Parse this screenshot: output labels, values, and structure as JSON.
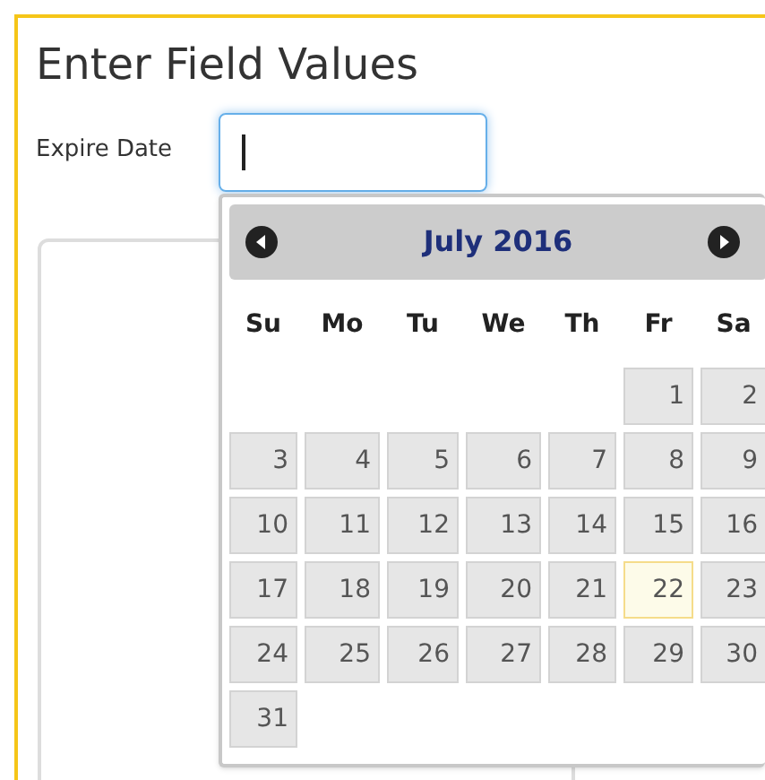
{
  "title": "Enter Field Values",
  "field": {
    "label": "Expire Date",
    "focused": true
  },
  "datepicker": {
    "month_title": "July 2016",
    "weekdays": [
      "Su",
      "Mo",
      "Tu",
      "We",
      "Th",
      "Fr",
      "Sa"
    ],
    "weeks": [
      [
        {
          "label": "1",
          "today": false
        },
        {
          "label": "2",
          "today": false
        }
      ],
      [
        {
          "label": "3",
          "today": false
        },
        {
          "label": "4",
          "today": false
        },
        {
          "label": "5",
          "today": false
        },
        {
          "label": "6",
          "today": false
        },
        {
          "label": "7",
          "today": false
        },
        {
          "label": "8",
          "today": false
        },
        {
          "label": "9",
          "today": false
        }
      ],
      [
        {
          "label": "10",
          "today": false
        },
        {
          "label": "11",
          "today": false
        },
        {
          "label": "12",
          "today": false
        },
        {
          "label": "13",
          "today": false
        },
        {
          "label": "14",
          "today": false
        },
        {
          "label": "15",
          "today": false
        },
        {
          "label": "16",
          "today": false
        }
      ],
      [
        {
          "label": "17",
          "today": false
        },
        {
          "label": "18",
          "today": false
        },
        {
          "label": "19",
          "today": false
        },
        {
          "label": "20",
          "today": false
        },
        {
          "label": "21",
          "today": false
        },
        {
          "label": "22",
          "today": true
        },
        {
          "label": "23",
          "today": false
        }
      ],
      [
        {
          "label": "24",
          "today": false
        },
        {
          "label": "25",
          "today": false
        },
        {
          "label": "26",
          "today": false
        },
        {
          "label": "27",
          "today": false
        },
        {
          "label": "28",
          "today": false
        },
        {
          "label": "29",
          "today": false
        },
        {
          "label": "30",
          "today": false
        }
      ],
      [
        {
          "label": "31",
          "today": false
        }
      ]
    ]
  }
}
